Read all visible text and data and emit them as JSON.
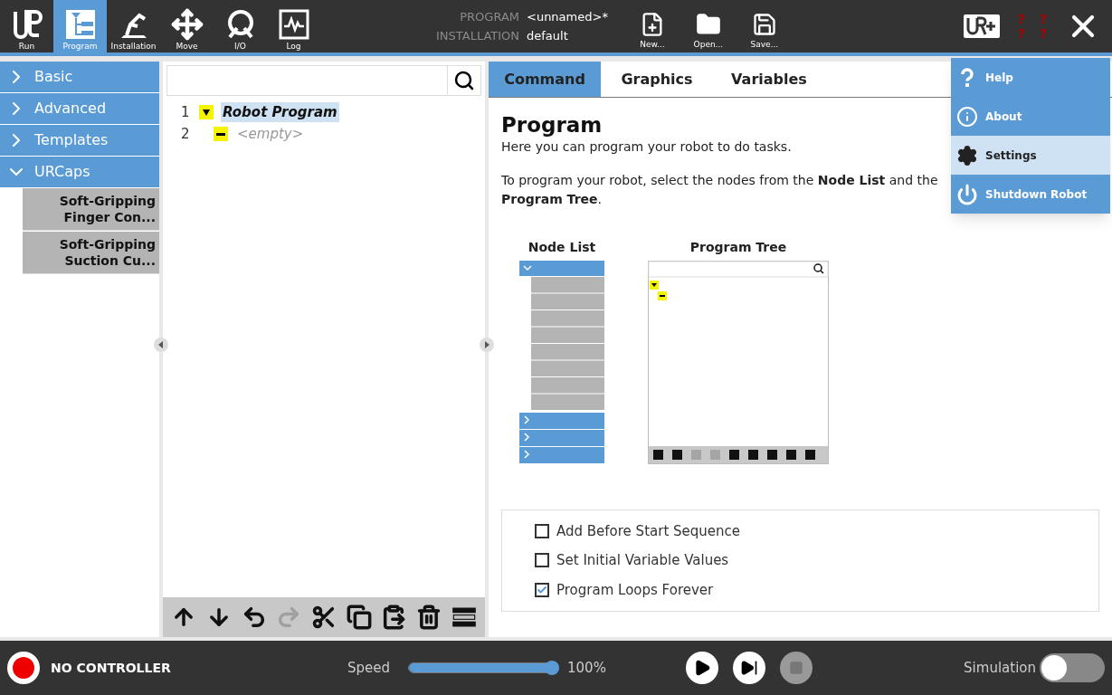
{
  "top_nav": [
    {
      "label": "Run",
      "kind": "run",
      "selected": false
    },
    {
      "label": "Program",
      "kind": "program",
      "selected": true
    },
    {
      "label": "Installation",
      "kind": "installation",
      "selected": false
    },
    {
      "label": "Move",
      "kind": "move",
      "selected": false
    },
    {
      "label": "I/O",
      "kind": "io",
      "selected": false
    },
    {
      "label": "Log",
      "kind": "log",
      "selected": false
    }
  ],
  "program_info": [
    {
      "label": "PROGRAM",
      "value": "<unnamed>*"
    },
    {
      "label": "INSTALLATION",
      "value": "default"
    }
  ],
  "file_buttons": [
    {
      "label": "New...",
      "kind": "new"
    },
    {
      "label": "Open...",
      "kind": "open"
    },
    {
      "label": "Save...",
      "kind": "save"
    }
  ],
  "warning_marks": [
    "?",
    "?",
    "?",
    "?"
  ],
  "menu": [
    {
      "label": "Help",
      "kind": "help",
      "selected": false
    },
    {
      "label": "About",
      "kind": "about",
      "selected": false
    },
    {
      "label": "Settings",
      "kind": "settings",
      "selected": true
    },
    {
      "label": "Shutdown Robot",
      "kind": "shutdown",
      "selected": false
    }
  ],
  "sidebar": [
    {
      "label": "Basic",
      "expanded": false
    },
    {
      "label": "Advanced",
      "expanded": false
    },
    {
      "label": "Templates",
      "expanded": false
    },
    {
      "label": "URCaps",
      "expanded": true,
      "children": [
        {
          "label": "Soft-Gripping Finger Con..."
        },
        {
          "label": "Soft-Gripping Suction Cu..."
        }
      ]
    }
  ],
  "tree": [
    {
      "number": "1",
      "label": "Robot Program",
      "kind": "root",
      "selected": true
    },
    {
      "number": "2",
      "label": "<empty>",
      "kind": "empty",
      "selected": false
    }
  ],
  "tree_toolbar": [
    {
      "kind": "up",
      "disabled": false
    },
    {
      "kind": "down",
      "disabled": false
    },
    {
      "kind": "undo",
      "disabled": false
    },
    {
      "kind": "redo",
      "disabled": true
    },
    {
      "kind": "cut",
      "disabled": false
    },
    {
      "kind": "copy",
      "disabled": false
    },
    {
      "kind": "paste",
      "disabled": false
    },
    {
      "kind": "delete",
      "disabled": false
    },
    {
      "kind": "suppress",
      "disabled": false
    }
  ],
  "tabs": [
    {
      "label": "Command",
      "selected": true
    },
    {
      "label": "Graphics",
      "selected": false
    },
    {
      "label": "Variables",
      "selected": false
    }
  ],
  "content": {
    "title": "Program",
    "intro": "Here you can program your robot to do tasks.",
    "instructions": "To program your robot, select the nodes from the **Node List** and the **Program Tree**.",
    "node_list_heading": "Node List",
    "program_tree_heading": "Program Tree"
  },
  "options": [
    {
      "label": "Add Before Start Sequence",
      "checked": false
    },
    {
      "label": "Set Initial Variable Values",
      "checked": false
    },
    {
      "label": "Program Loops Forever",
      "checked": true
    }
  ],
  "status_bar": {
    "controller": "NO CONTROLLER",
    "speed_label": "Speed",
    "speed": {
      "level": 1.0,
      "reading": "100%"
    },
    "simulation": {
      "label": "Simulation",
      "on": false
    }
  }
}
